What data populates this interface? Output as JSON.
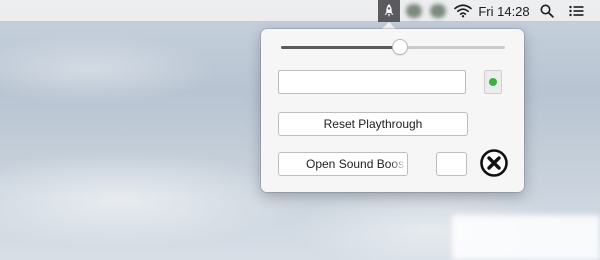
{
  "menubar": {
    "clock": "Fri 14:28",
    "icons": [
      "app-rocket-icon",
      "blurred-status-icon",
      "blurred-status-icon",
      "wifi-icon",
      "search-icon",
      "list-icon"
    ]
  },
  "popover": {
    "slider_value": 0.53,
    "text_field_value": "",
    "reset_button_label": "Reset Playthrough",
    "open_button_label": "Open Sound Boos",
    "close_icon": "close-circle-icon"
  },
  "colors": {
    "status_dot": "#3cb340",
    "popover_bg": "#f6f6f6"
  }
}
